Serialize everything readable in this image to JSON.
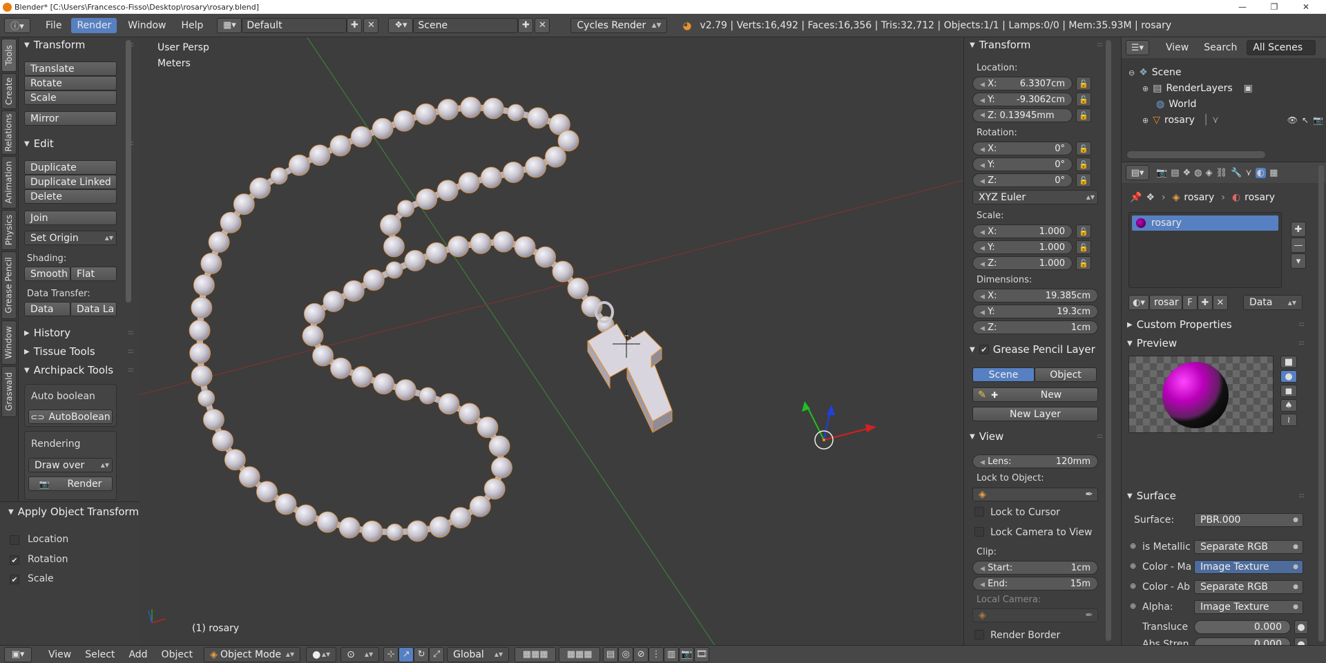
{
  "window": {
    "title": "Blender* [C:\\Users\\Francesco-Fisso\\Desktop\\rosary\\rosary.blend]",
    "minimize": "—",
    "maximize": "❐",
    "close": "✕"
  },
  "topbar": {
    "menus": [
      "File",
      "Render",
      "Window",
      "Help"
    ],
    "selected_menu": "Render",
    "layout": "Default",
    "scene": "Scene",
    "engine": "Cycles Render",
    "stats": "v2.79 | Verts:16,492 | Faces:16,356 | Tris:32,712 | Objects:1/1 | Lamps:0/0 | Mem:35.93M | rosary"
  },
  "tabs": [
    "Tools",
    "Create",
    "Relations",
    "Animation",
    "Physics",
    "Grease Pencil",
    "Window",
    "Graswald"
  ],
  "toolshelf": {
    "transform_title": "Transform",
    "translate": "Translate",
    "rotate": "Rotate",
    "scale": "Scale",
    "mirror": "Mirror",
    "edit_title": "Edit",
    "duplicate": "Duplicate",
    "duplicate_linked": "Duplicate Linked",
    "delete": "Delete",
    "join": "Join",
    "set_origin": "Set Origin",
    "shading_label": "Shading:",
    "smooth": "Smooth",
    "flat": "Flat",
    "data_transfer_label": "Data Transfer:",
    "data": "Data",
    "data_la": "Data La",
    "history": "History",
    "tissue_tools": "Tissue Tools",
    "archipack": "Archipack Tools",
    "auto_boolean_label": "Auto boolean",
    "autoboolean_btn": "AutoBoolean",
    "rendering_label": "Rendering",
    "draw_over": "Draw over",
    "render_btn": "Render"
  },
  "operator": {
    "title": "Apply Object Transform",
    "location": "Location",
    "rotation": "Rotation",
    "scale": "Scale",
    "location_checked": false,
    "rotation_checked": true,
    "scale_checked": true
  },
  "viewport": {
    "view_name": "User Persp",
    "units": "Meters",
    "object_label": "(1) rosary"
  },
  "npanel": {
    "transform_title": "Transform",
    "location_label": "Location:",
    "loc_x": "X:",
    "loc_x_val": "6.3307cm",
    "loc_y": "Y:",
    "loc_y_val": "-9.3062cm",
    "loc_z": "Z: 0.13945mm",
    "rotation_label": "Rotation:",
    "rot_x": "X:",
    "rot_x_val": "0°",
    "rot_y": "Y:",
    "rot_y_val": "0°",
    "rot_z": "Z:",
    "rot_z_val": "0°",
    "euler": "XYZ Euler",
    "scale_label": "Scale:",
    "sc_x": "X:",
    "sc_x_val": "1.000",
    "sc_y": "Y:",
    "sc_y_val": "1.000",
    "sc_z": "Z:",
    "sc_z_val": "1.000",
    "dimensions_label": "Dimensions:",
    "dim_x": "X:",
    "dim_x_val": "19.385cm",
    "dim_y": "Y:",
    "dim_y_val": "19.3cm",
    "dim_z": "Z:",
    "dim_z_val": "1cm",
    "grease_title": "Grease Pencil Layer",
    "gp_scene": "Scene",
    "gp_object": "Object",
    "gp_new": "New",
    "gp_new_layer": "New Layer",
    "view_title": "View",
    "lens_label": "Lens:",
    "lens_val": "120mm",
    "lock_to_object": "Lock to Object:",
    "lock_to_cursor": "Lock to Cursor",
    "lock_camera": "Lock Camera to View",
    "clip_label": "Clip:",
    "clip_start": "Start:",
    "clip_start_val": "1cm",
    "clip_end": "End:",
    "clip_end_val": "15m",
    "local_camera": "Local Camera:",
    "render_border": "Render Border"
  },
  "outliner": {
    "view": "View",
    "search": "Search",
    "all_scenes": "All Scenes",
    "items": [
      "Scene",
      "RenderLayers",
      "World",
      "rosary"
    ]
  },
  "properties": {
    "breadcrumb_obj": "rosary",
    "breadcrumb_mat": "rosary",
    "material_slot": "rosary",
    "mat_name": "rosar",
    "mat_f": "F",
    "data_dd": "Data",
    "custom_props": "Custom Properties",
    "preview": "Preview",
    "surface_title": "Surface",
    "surface_label": "Surface:",
    "surface_val": "PBR.000",
    "rows": [
      {
        "label": "is Metallic",
        "value": "Separate RGB",
        "highlight": false
      },
      {
        "label": "Color - Ma",
        "value": "Image Texture",
        "highlight": true
      },
      {
        "label": "Color - Ab",
        "value": "Separate RGB",
        "highlight": false
      },
      {
        "label": "Alpha:",
        "value": "Image Texture",
        "highlight": false
      }
    ],
    "transluce_label": "Transluce",
    "transluce_val": "0.000",
    "absstren_label": "Abs Stren",
    "absstren_val": "0.000"
  },
  "bottombar": {
    "view": "View",
    "select": "Select",
    "add": "Add",
    "object": "Object",
    "mode": "Object Mode",
    "orientation": "Global"
  },
  "colors": {
    "selection_blue": "#5680c2",
    "beads": "#c9c6cf",
    "outline_orange": "#e8902f",
    "axis_red": "#a02828",
    "axis_green": "#2a8a2a"
  }
}
